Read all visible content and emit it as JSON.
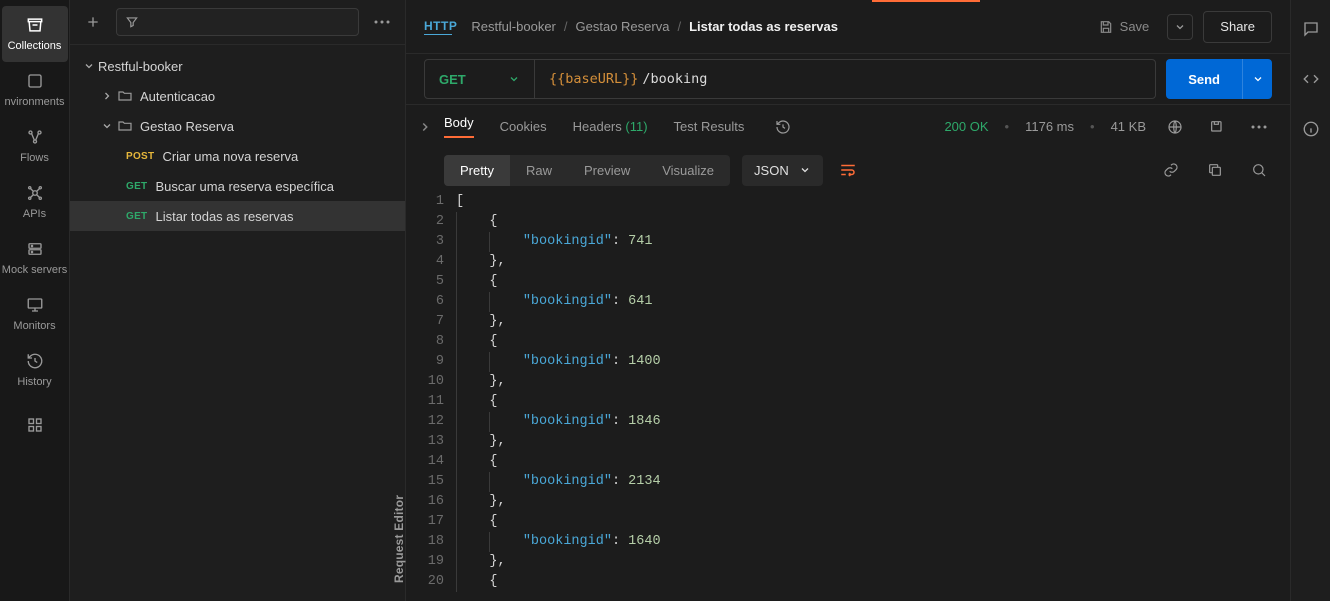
{
  "left_rail": {
    "items": [
      {
        "label": "Collections"
      },
      {
        "label": "nvironments"
      },
      {
        "label": "Flows"
      },
      {
        "label": "APIs"
      },
      {
        "label": "Mock servers"
      },
      {
        "label": "Monitors"
      },
      {
        "label": "History"
      }
    ]
  },
  "sidebar": {
    "collection": "Restful-booker",
    "folder1": "Autenticacao",
    "folder2": "Gestao Reserva",
    "requests": [
      {
        "method": "POST",
        "name": "Criar uma nova reserva"
      },
      {
        "method": "GET",
        "name": "Buscar uma reserva específica"
      },
      {
        "method": "GET",
        "name": "Listar todas as reservas"
      }
    ]
  },
  "topbar": {
    "http_badge": "HTTP",
    "crumb1": "Restful-booker",
    "crumb2": "Gestao Reserva",
    "crumb3": "Listar todas as reservas",
    "save": "Save",
    "share": "Share"
  },
  "url": {
    "method": "GET",
    "var": "{{baseURL}}",
    "path": "/booking",
    "send": "Send"
  },
  "response": {
    "tabs": {
      "body": "Body",
      "cookies": "Cookies",
      "headers": "Headers",
      "headers_count": "(11)",
      "tests": "Test Results"
    },
    "status": "200 OK",
    "time": "1176 ms",
    "size": "41 KB",
    "views": {
      "pretty": "Pretty",
      "raw": "Raw",
      "preview": "Preview",
      "visualize": "Visualize"
    },
    "lang": "JSON"
  },
  "code": {
    "key": "\"bookingid\"",
    "values": [
      "741",
      "641",
      "1400",
      "1846",
      "2134",
      "1640"
    ]
  },
  "vlabel": "Request Editor"
}
